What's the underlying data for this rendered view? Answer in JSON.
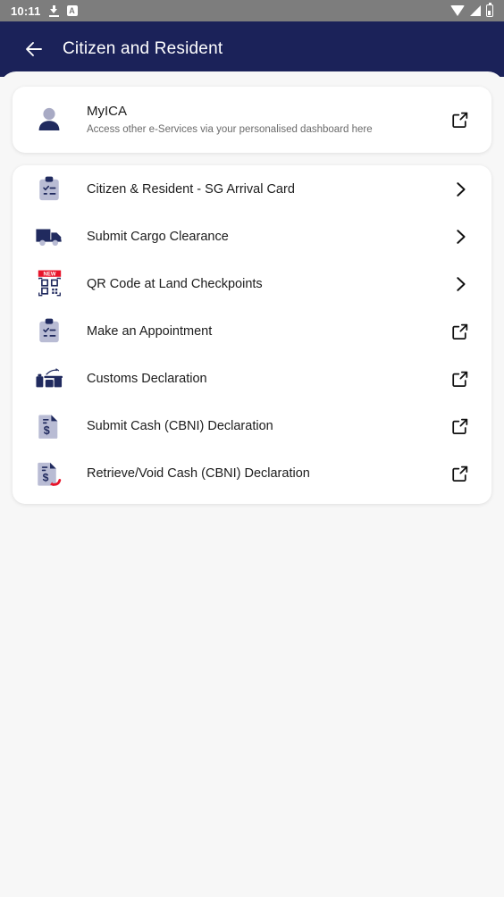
{
  "statusbar": {
    "time": "10:11",
    "left_icons": [
      "download-icon",
      "a-badge-icon"
    ],
    "right_icons": [
      "wifi-icon",
      "cellular-signal-icon",
      "battery-icon"
    ],
    "a_badge_label": "A",
    "background": "#7d7d7d"
  },
  "appbar": {
    "title": "Citizen and Resident",
    "back_icon": "arrow-left-icon",
    "background": "#1b2259",
    "text_color": "#ffffff"
  },
  "myica_card": {
    "icon": "person-avatar-icon",
    "title": "MyICA",
    "subtitle": "Access other e-Services via your personalised dashboard here",
    "trailing_icon": "external-link-icon"
  },
  "services": [
    {
      "icon": "clipboard-checklist-icon",
      "label": "Citizen & Resident - SG Arrival Card",
      "trailing_icon": "chevron-right-icon",
      "badge": ""
    },
    {
      "icon": "truck-icon",
      "label": "Submit Cargo Clearance",
      "trailing_icon": "chevron-right-icon",
      "badge": ""
    },
    {
      "icon": "qr-code-icon",
      "label": "QR Code at Land Checkpoints",
      "trailing_icon": "chevron-right-icon",
      "badge": "NEW"
    },
    {
      "icon": "clipboard-checklist-icon",
      "label": "Make an Appointment",
      "trailing_icon": "external-link-icon",
      "badge": ""
    },
    {
      "icon": "customs-luggage-icon",
      "label": "Customs Declaration",
      "trailing_icon": "external-link-icon",
      "badge": ""
    },
    {
      "icon": "cash-document-icon",
      "label": "Submit Cash (CBNI) Declaration",
      "trailing_icon": "external-link-icon",
      "badge": ""
    },
    {
      "icon": "cash-document-undo-icon",
      "label": "Retrieve/Void Cash (CBNI) Declaration",
      "trailing_icon": "external-link-icon",
      "badge": ""
    }
  ],
  "colors": {
    "brand_navy": "#1b2259",
    "icon_navy": "#202a5e",
    "icon_lavender": "#b9bcd4",
    "page_background": "#f7f7f7",
    "card_background": "#ffffff",
    "badge_red": "#e8152b",
    "primary_text": "#1c1c1c",
    "secondary_text": "#6b6b6b"
  }
}
